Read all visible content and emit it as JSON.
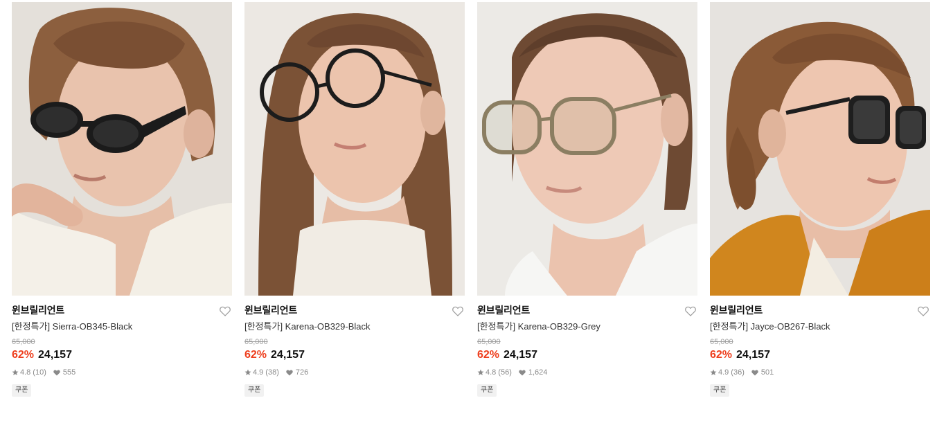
{
  "products": [
    {
      "brand": "윈브릴리언트",
      "name": "[한정특가] Sierra-OB345-Black",
      "original_price": "65,000",
      "discount": "62%",
      "price": "24,157",
      "rating": "4.8",
      "review_count": "(10)",
      "likes": "555",
      "badge": "쿠폰",
      "photo_icon": "model-sunglasses-photo"
    },
    {
      "brand": "윈브릴리언트",
      "name": "[한정특가] Karena-OB329-Black",
      "original_price": "65,000",
      "discount": "62%",
      "price": "24,157",
      "rating": "4.9",
      "review_count": "(38)",
      "likes": "726",
      "badge": "쿠폰",
      "photo_icon": "model-eyeglasses-photo"
    },
    {
      "brand": "윈브릴리언트",
      "name": "[한정특가] Karena-OB329-Grey",
      "original_price": "65,000",
      "discount": "62%",
      "price": "24,157",
      "rating": "4.8",
      "review_count": "(56)",
      "likes": "1,624",
      "badge": "쿠폰",
      "photo_icon": "model-eyeglasses-photo"
    },
    {
      "brand": "윈브릴리언트",
      "name": "[한정특가] Jayce-OB267-Black",
      "original_price": "65,000",
      "discount": "62%",
      "price": "24,157",
      "rating": "4.9",
      "review_count": "(36)",
      "likes": "501",
      "badge": "쿠폰",
      "photo_icon": "model-sunglasses-photo"
    }
  ],
  "colors": {
    "discount": "#ee3e1d",
    "muted": "#8a8a8a",
    "heart_outline": "#9a9a9a"
  },
  "icons": {
    "wishlist": "heart-outline-icon",
    "rating": "star-icon",
    "likes": "heart-filled-icon"
  }
}
